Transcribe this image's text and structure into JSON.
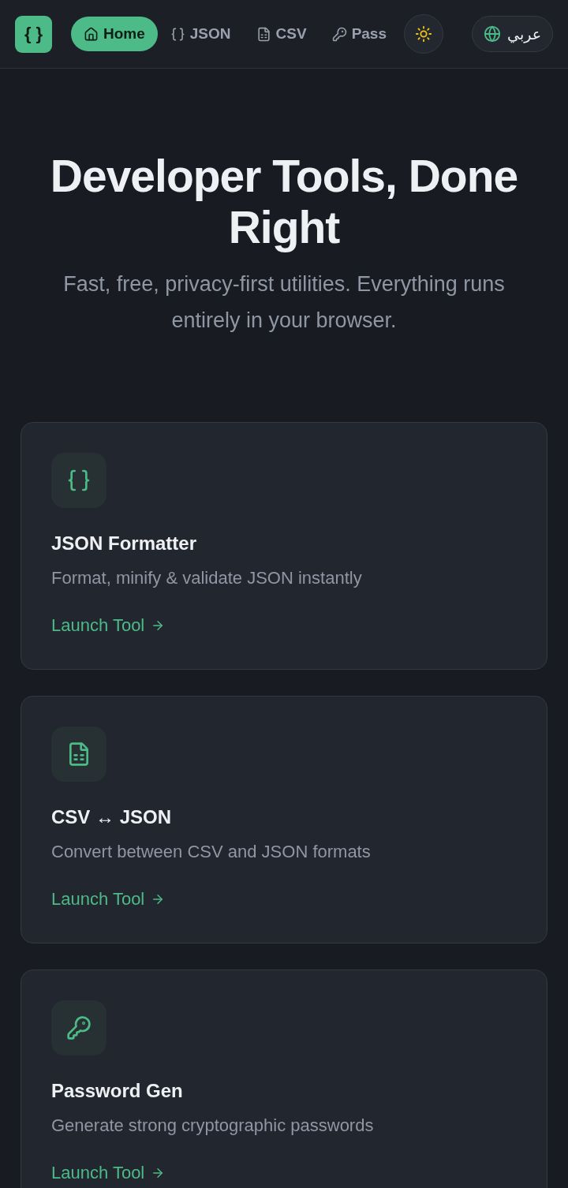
{
  "header": {
    "logo": "{ }",
    "nav": [
      {
        "label": "Home",
        "selected": true
      },
      {
        "label": "JSON",
        "selected": false
      },
      {
        "label": "CSV",
        "selected": false
      },
      {
        "label": "Pass",
        "selected": false
      }
    ],
    "language": "عربي"
  },
  "hero": {
    "title": "Developer Tools, Done Right",
    "subtitle": "Fast, free, privacy-first utilities. Everything runs entirely in your browser."
  },
  "tools": [
    {
      "title": "JSON Formatter",
      "description": "Format, minify & validate JSON instantly",
      "link": "Launch Tool"
    },
    {
      "title": "CSV ↔ JSON",
      "description": "Convert between CSV and JSON formats",
      "link": "Launch Tool"
    },
    {
      "title": "Password Gen",
      "description": "Generate strong cryptographic passwords",
      "link": "Launch Tool"
    }
  ]
}
